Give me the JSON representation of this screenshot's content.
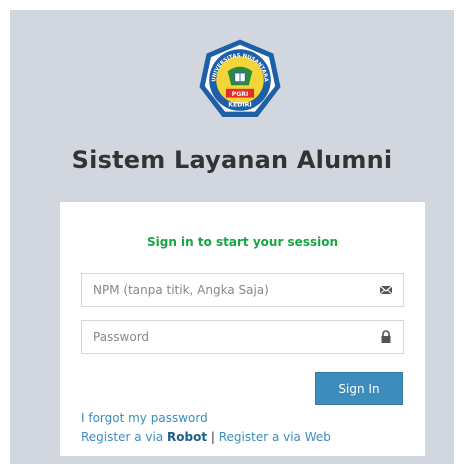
{
  "header": {
    "title": "Sistem Layanan Alumni",
    "logo": {
      "top_text": "UNIVERSITAS NUSANTARA",
      "badge_text": "PGRI",
      "bottom_text": "KEDIRI",
      "colors": {
        "ring": "#1f5fa8",
        "fill": "#f3d53a",
        "ribbon": "#e32d2d"
      }
    }
  },
  "login": {
    "message": "Sign in to start your session",
    "npm_placeholder": "NPM (tanpa titik, Angka Saja)",
    "npm_icon": "envelope-icon",
    "password_placeholder": "Password",
    "password_icon": "lock-icon",
    "signin_label": "Sign In",
    "forgot_label": "I forgot my password",
    "register_prefix": "Register a via ",
    "register_robot": "Robot",
    "register_separator": " | ",
    "register_web": "Register a via Web"
  },
  "colors": {
    "background": "#d2d6de",
    "accent": "#3c8dbc",
    "success_text": "#18a546"
  }
}
